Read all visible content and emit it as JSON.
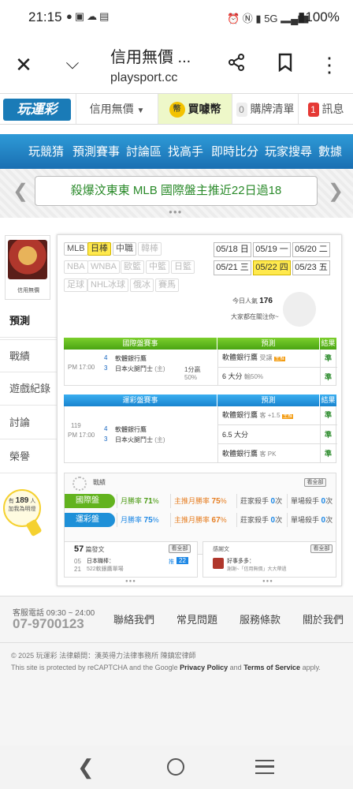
{
  "status_bar": {
    "time": "21:15",
    "battery": "100%",
    "network": "5G"
  },
  "browser": {
    "title": "信用無價 ...",
    "url": "playsport.cc"
  },
  "site_header": {
    "logo": "玩運彩",
    "user_menu": "信用無價",
    "coin_badge": "幣",
    "buy_coins": "買噱幣",
    "cart_count": "0",
    "cart_label": "購牌清單",
    "msg_count": "1",
    "msg_label": "訊息"
  },
  "nav": [
    "玩競猜",
    "預測賽事",
    "討論區",
    "找高手",
    "即時比分",
    "玩家搜尋",
    "數據"
  ],
  "banner": {
    "text": "殺爆汶東東 MLB 國際盤主推近22日過18"
  },
  "profile": {
    "name": "信用無價"
  },
  "side_menu": [
    "預測",
    "戰績",
    "遊戲紀錄",
    "討論",
    "榮譽"
  ],
  "leagues": [
    {
      "label": "MLB",
      "state": "normal"
    },
    {
      "label": "日棒",
      "state": "on"
    },
    {
      "label": "中職",
      "state": "normal"
    },
    {
      "label": "韓棒",
      "state": "dim"
    },
    {
      "label": "NBA",
      "state": "dim"
    },
    {
      "label": "WNBA",
      "state": "dim"
    },
    {
      "label": "歐籃",
      "state": "dim"
    },
    {
      "label": "中籃",
      "state": "dim"
    },
    {
      "label": "日籃",
      "state": "dim"
    },
    {
      "label": "足球",
      "state": "dim"
    },
    {
      "label": "NHL冰球",
      "state": "dim"
    },
    {
      "label": "俄冰",
      "state": "dim"
    },
    {
      "label": "賽馬",
      "state": "dim"
    }
  ],
  "dates": [
    {
      "d": "05/18",
      "w": "日",
      "on": false
    },
    {
      "d": "05/19",
      "w": "一",
      "on": false
    },
    {
      "d": "05/20",
      "w": "二",
      "on": false
    },
    {
      "d": "05/21",
      "w": "三",
      "on": false
    },
    {
      "d": "05/22",
      "w": "四",
      "on": true
    },
    {
      "d": "05/23",
      "w": "五",
      "on": false
    }
  ],
  "popularity": {
    "label": "今日人氣",
    "value": "176",
    "watching": "大家都在關注你~"
  },
  "intl": {
    "h_event": "國際盤賽事",
    "h_pred": "預測",
    "h_result": "結果",
    "time": "PM 17:00",
    "team_a_no": "4",
    "team_a": "軟體銀行鷹",
    "team_b_no": "3",
    "team_b": "日本火腿鬥士",
    "home_mark": "(主)",
    "line": "1分贏",
    "line_pct": "50%",
    "pred1": "軟體銀行鷹",
    "pred1_tag": "受讓",
    "pred1_badge": "主推",
    "res1": "準",
    "pred2": "6 大分",
    "pred2_tag": "輸50%",
    "res2": "準"
  },
  "lottery": {
    "h_event": "運彩盤賽事",
    "h_pred": "預測",
    "h_result": "結果",
    "game_no": "119",
    "time": "PM 17:00",
    "team_a_no": "4",
    "team_a": "軟體銀行鷹",
    "team_b_no": "3",
    "team_b": "日本火腿鬥士",
    "home_mark": "(主)",
    "pred1": "軟體銀行鷹",
    "pred1_tag": "客 +1.5",
    "pred1_badge": "主推",
    "res1": "準",
    "pred2": "6.5 大分",
    "res2": "準",
    "pred3": "軟體銀行鷹",
    "pred3_tag": "客 PK",
    "res3": "準"
  },
  "record": {
    "title": "戰績",
    "see_all": "看全部",
    "rows": [
      {
        "tag": "國際盤",
        "month": "月勝率",
        "month_v": "71",
        "main": "主推月勝率",
        "main_v": "75",
        "kill": "莊家殺手",
        "kill_v": "0",
        "single": "單場殺手",
        "single_v": "0"
      },
      {
        "tag": "運彩盤",
        "month": "月勝率",
        "month_v": "75",
        "main": "主推月勝率",
        "main_v": "67",
        "kill": "莊家殺手",
        "kill_v": "0",
        "single": "單場殺手",
        "single_v": "0"
      }
    ],
    "pct": "%",
    "times": "次"
  },
  "posts": {
    "count": "57",
    "label": "篇發文",
    "see_all": "看全部",
    "item_date_m": "05",
    "item_date_d": "21",
    "item_title": "日本職棒：",
    "item_sub": "522軟銀鷹單場",
    "item_tag": "推",
    "item_num": "22"
  },
  "replies": {
    "label": "感謝文",
    "see_all": "看全部",
    "item_user": "好事多多：",
    "item_text": "謝謝~「信用無價」大大帶過"
  },
  "fans": {
    "prefix": "有",
    "count": "189",
    "unit": "人",
    "text": "加我為明燈"
  },
  "footer": {
    "phone_label": "客服電話 09:30 ~ 24:00",
    "phone": "07-9700123",
    "links": [
      "聯絡我們",
      "常見問題",
      "服務條款",
      "關於我們"
    ],
    "copyright": "© 2025 玩運彩 法律顧問：漢英得力法律事務所 陳鎮宏律師",
    "recaptcha_pre": "This site is protected by reCAPTCHA and the Google ",
    "privacy": "Privacy Policy",
    "and": " and ",
    "terms": "Terms of Service",
    "apply": " apply."
  }
}
